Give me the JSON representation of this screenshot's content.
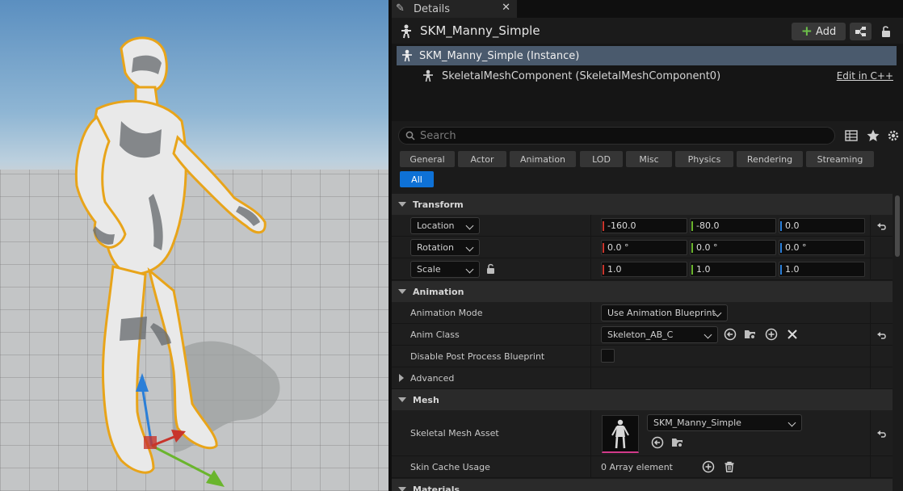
{
  "tab": {
    "icon": "pencil-icon",
    "label": "Details",
    "close": "✕"
  },
  "actor": {
    "title": "SKM_Manny_Simple",
    "add_label": "Add"
  },
  "tree": {
    "instance": "SKM_Manny_Simple (Instance)",
    "component": "SkeletalMeshComponent (SkeletalMeshComponent0)",
    "edit_link": "Edit in C++"
  },
  "search": {
    "placeholder": "Search"
  },
  "filters": [
    "General",
    "Actor",
    "Animation",
    "LOD",
    "Misc",
    "Physics",
    "Rendering",
    "Streaming",
    "All"
  ],
  "filter_active": "All",
  "transform": {
    "header": "Transform",
    "location": {
      "label": "Location",
      "x": "-160.0",
      "y": "-80.0",
      "z": "0.0"
    },
    "rotation": {
      "label": "Rotation",
      "x": "0.0 °",
      "y": "0.0 °",
      "z": "0.0 °"
    },
    "scale": {
      "label": "Scale",
      "x": "1.0",
      "y": "1.0",
      "z": "1.0"
    }
  },
  "animation": {
    "header": "Animation",
    "mode_label": "Animation Mode",
    "mode_value": "Use Animation Blueprint",
    "class_label": "Anim Class",
    "class_value": "Skeleton_AB_C",
    "disable_pp_label": "Disable Post Process Blueprint",
    "advanced_label": "Advanced"
  },
  "mesh": {
    "header": "Mesh",
    "asset_label": "Skeletal Mesh Asset",
    "asset_value": "SKM_Manny_Simple",
    "skin_cache_label": "Skin Cache Usage",
    "skin_cache_value": "0 Array element"
  },
  "materials": {
    "header": "Materials"
  },
  "colors": {
    "accent": "#0e71d6",
    "axis_x": "#c8352c",
    "axis_y": "#6ab52d",
    "axis_z": "#2b7fd8",
    "selection": "#e8a41a"
  }
}
